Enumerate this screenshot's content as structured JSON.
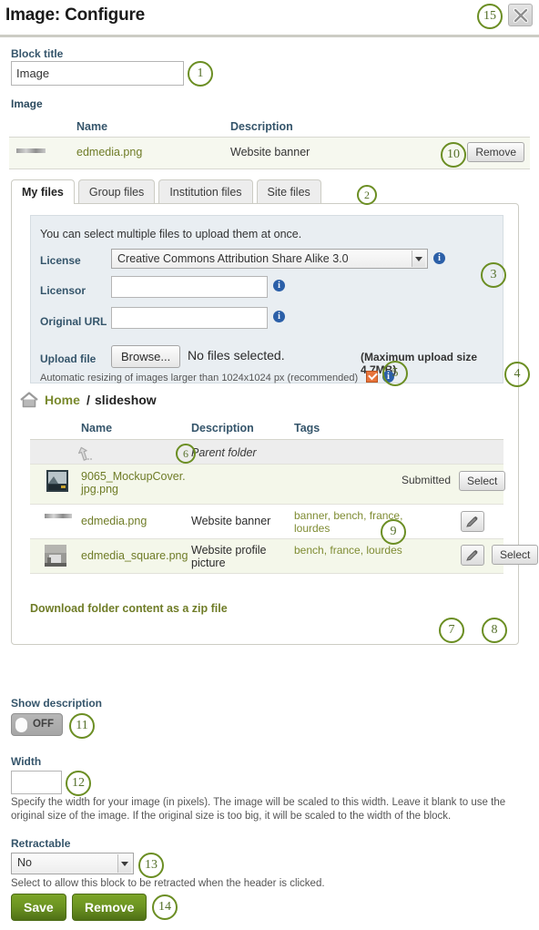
{
  "header": {
    "title": "Image: Configure",
    "close_label": "×"
  },
  "block_title": {
    "label": "Block title",
    "value": "Image"
  },
  "image_section": {
    "label": "Image",
    "columns": {
      "name": "Name",
      "description": "Description"
    },
    "row": {
      "name": "edmedia.png",
      "description": "Website banner",
      "remove_label": "Remove"
    }
  },
  "tabs": [
    {
      "label": "My files",
      "active": true
    },
    {
      "label": "Group files",
      "active": false
    },
    {
      "label": "Institution files",
      "active": false
    },
    {
      "label": "Site files",
      "active": false
    }
  ],
  "upload": {
    "intro": "You can select multiple files to upload them at once.",
    "license_label": "License",
    "license_value": "Creative Commons Attribution Share Alike 3.0",
    "licensor_label": "Licensor",
    "licensor_value": "",
    "original_url_label": "Original URL",
    "original_url_value": "",
    "upload_file_label": "Upload file",
    "browse_label": "Browse...",
    "no_files_text": "No files selected.",
    "max_size_text": "(Maximum upload size 4.7MB)",
    "resize_note": "Automatic resizing of images larger than 1024x1024 px (recommended)",
    "resize_checked": true,
    "info_label": "i"
  },
  "breadcrumb": {
    "home": "Home",
    "separator": "/",
    "current": "slideshow"
  },
  "filelist": {
    "columns": {
      "name": "Name",
      "description": "Description",
      "tags": "Tags"
    },
    "parent_row": {
      "description": "Parent folder"
    },
    "rows": [
      {
        "name": "9065_MockupCover.jpg.png",
        "description": "",
        "tags": "",
        "status": "Submitted",
        "select_label": "Select",
        "has_edit": false,
        "has_select": true
      },
      {
        "name": "edmedia.png",
        "description": "Website banner",
        "tags": "banner, bench, france, lourdes",
        "status": "",
        "select_label": "",
        "has_edit": true,
        "has_select": false
      },
      {
        "name": "edmedia_square.png",
        "description": "Website profile picture",
        "tags": "bench, france, lourdes",
        "status": "",
        "select_label": "Select",
        "has_edit": true,
        "has_select": true
      }
    ],
    "download_zip_label": "Download folder content as a zip file"
  },
  "show_description": {
    "label": "Show description",
    "state": "OFF"
  },
  "width": {
    "label": "Width",
    "value": "",
    "help": "Specify the width for your image (in pixels). The image will be scaled to this width. Leave it blank to use the original size of the image. If the original size is too big, it will be scaled to the width of the block."
  },
  "retractable": {
    "label": "Retractable",
    "value": "No",
    "help": "Select to allow this block to be retracted when the header is clicked."
  },
  "actions": {
    "save_label": "Save",
    "remove_label": "Remove"
  },
  "callouts": {
    "c1": "1",
    "c2": "2",
    "c3": "3",
    "c4": "4",
    "c5": "5",
    "c6": "6",
    "c7": "7",
    "c8": "8",
    "c9": "9",
    "c10": "10",
    "c11": "11",
    "c12": "12",
    "c13": "13",
    "c14": "14",
    "c15": "15"
  },
  "colors": {
    "accent_green": "#6b8e23",
    "link_green": "#6f7c27",
    "label_blue": "#35556b",
    "panel_blue": "#e9eef2",
    "row_tint": "#f4f7ea"
  }
}
